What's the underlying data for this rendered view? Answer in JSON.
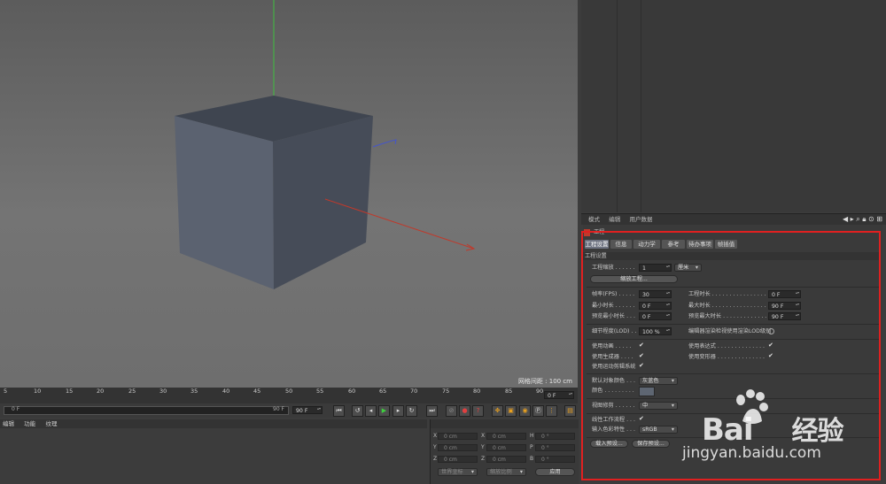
{
  "viewport": {
    "grid_spacing": "网格间距 : 100 cm"
  },
  "attributes": {
    "menu": [
      "模式",
      "编辑",
      "用户数据"
    ],
    "object_title": "工程",
    "tabs": [
      "工程设置",
      "信息",
      "动力学",
      "参考",
      "待办事项",
      "帧插值"
    ],
    "section_title": "工程设置",
    "project_scale_label": "工程缩放 . . . . . .",
    "project_scale_value": "1",
    "project_scale_unit": "厘米",
    "scale_project_button": "缩放工程...",
    "fps_label": "帧率(FPS) . . . . .",
    "fps_value": "30",
    "min_time_label": "最小时长 . . . . . .",
    "min_time_value": "0 F",
    "preview_min_label": "预览最小时长 . . .",
    "preview_min_value": "0 F",
    "project_time_label": "工程时长 . . . . . . . . . . . . . . . .",
    "project_time_value": "0 F",
    "max_time_label": "最大时长 . . . . . . . . . . . . . . . .",
    "max_time_value": "90 F",
    "preview_max_label": "预览最大时长 . . . . . . . . . . . . .",
    "preview_max_value": "90 F",
    "lod_label": "细节程度(LOD) . .",
    "lod_value": "100 %",
    "render_lod_label": "编辑器渲染检视使用渲染LOD级别",
    "use_animation_label": "使用动画 . . . . .",
    "use_generators_label": "使用生成器 . . . .",
    "use_motion_label": "使用运动剪辑系统",
    "use_expressions_label": "使用表达式 . . . . . . . . . . . . . . .",
    "use_deformers_label": "使用变形器 . . . . . . . . . . . . . . .",
    "check_mark": "✔",
    "default_color_label": "默认对象颜色 . . .",
    "default_color_value": "灰蓝色",
    "color_label": "颜色 . . . . . . . . .",
    "view_clip_label": "视图修剪 . . . . . .",
    "view_clip_value": "中",
    "linear_workflow_label": "线性工作流程 . . .",
    "input_color_label": "输入色彩特性 . . .",
    "input_color_value": "sRGB",
    "load_preset_button": "载入预设...",
    "save_preset_button": "保存预设..."
  },
  "timeline": {
    "ticks": [
      "5",
      "10",
      "15",
      "20",
      "25",
      "30",
      "35",
      "40",
      "45",
      "50",
      "55",
      "60",
      "65",
      "70",
      "75",
      "80",
      "85",
      "90"
    ],
    "current_frame": "0 F",
    "start_frame": "0 F",
    "end_frame": "90 F",
    "range_end_label": "90 F"
  },
  "material_manager": {
    "menu": [
      "编辑",
      "功能",
      "纹理"
    ]
  },
  "coordinates": {
    "axes": [
      "X",
      "Y",
      "Z"
    ],
    "size_axes": [
      "X",
      "Y",
      "Z"
    ],
    "rot_axes": [
      "H",
      "P",
      "B"
    ],
    "pos_value": "0 cm",
    "rot_value": "0 °",
    "world_coords": "世界坐标",
    "scale_mode": "缩放比例",
    "apply_button": "应用"
  },
  "watermark": {
    "brand": "Bai",
    "brand_suffix": "经验",
    "url": "jingyan.baidu.com"
  },
  "colors": {
    "highlight": "#e02020",
    "active_tab": "#6d7280",
    "cube_top": "#3f4550",
    "cube_left": "#5b6270",
    "cube_right": "#454b57"
  }
}
